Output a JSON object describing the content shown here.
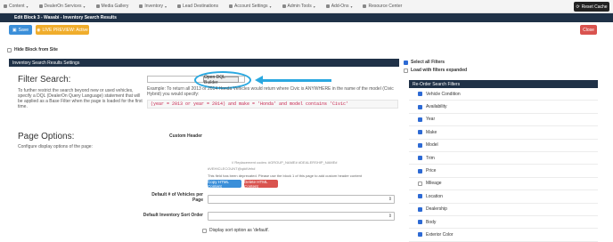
{
  "nav": {
    "items": [
      {
        "label": "Content",
        "icon": "content-icon"
      },
      {
        "label": "DealerOn Services",
        "icon": "services-icon"
      },
      {
        "label": "Media Gallery",
        "icon": "media-icon"
      },
      {
        "label": "Inventory",
        "icon": "inventory-icon"
      },
      {
        "label": "Lead Destinations",
        "icon": "lead-icon"
      },
      {
        "label": "Account Settings",
        "icon": "account-icon"
      },
      {
        "label": "Admin Tools",
        "icon": "admin-icon"
      },
      {
        "label": "Add-Ons",
        "icon": "addons-icon"
      },
      {
        "label": "Resource Center",
        "icon": "resource-icon"
      }
    ],
    "reset_label": "Reset Cache"
  },
  "title": "Edit Block 3 - Wasabi - Inventory Search Results",
  "toolbar": {
    "save_label": "Save",
    "preview_label": "LIVE PREVIEW: Active",
    "close_label": "Close"
  },
  "hide_block_label": "Hide Block from Site",
  "section_title": "Inventory Search Results Settings",
  "filter": {
    "title": "Filter Search:",
    "description": "To further restrict the search beyond new or used vehicles, specify a DQL (DealerOn Query Language) statement that will be applied as a Base Filter when the page is loaded for the first time.",
    "dql_button": "Open DQL Builder",
    "example": "Example: To return all 2013 or 2014 Honda Vehicles would return where Civic is ANYWHERE in the name of the model (Civic Hybrid) you would specify:",
    "code": "(year = 2013 or year = 2014) and make = 'Honda' and model contains 'Civic'"
  },
  "page_options": {
    "title": "Page Options:",
    "description": "Configure display options of the page:",
    "custom_header_label": "Custom Header",
    "placeholders": "// Replacement codes: #GROUP_NAME# #DEALERSHIP_NAME#",
    "vehicle_count": "#VEHICLECOUNT@q##Veh#",
    "deprecated": "This field has been deprecated. Please use the block 1 of this page to add custom header content",
    "copy_label": "Copy HTML Content",
    "delete_label": "Delete HTML Content",
    "vehicles_per_page_label": "Default # of Vehicles per Page",
    "sort_order_label": "Default Inventory Sort Order",
    "display_sort_label": "Display sort option as 'default'."
  },
  "right_panel": {
    "select_all_label": "Select all Filters",
    "load_expanded_label": "Load with filters expanded",
    "reorder_title": "Re-Order Search Filters",
    "filters": [
      {
        "label": "Vehicle Condition",
        "checked": true
      },
      {
        "label": "Availability",
        "checked": true
      },
      {
        "label": "Year",
        "checked": true
      },
      {
        "label": "Make",
        "checked": true
      },
      {
        "label": "Model",
        "checked": true
      },
      {
        "label": "Trim",
        "checked": true
      },
      {
        "label": "Price",
        "checked": true
      },
      {
        "label": "Mileage",
        "checked": false
      },
      {
        "label": "Location",
        "checked": true
      },
      {
        "label": "Dealership",
        "checked": true
      },
      {
        "label": "Body",
        "checked": true
      },
      {
        "label": "Exterior Color",
        "checked": true
      }
    ]
  },
  "colors": {
    "navy": "#1f3147",
    "blue": "#3b8fd9",
    "orange": "#f0ad2c",
    "red": "#d9534f",
    "highlight": "#2aa8e0"
  }
}
